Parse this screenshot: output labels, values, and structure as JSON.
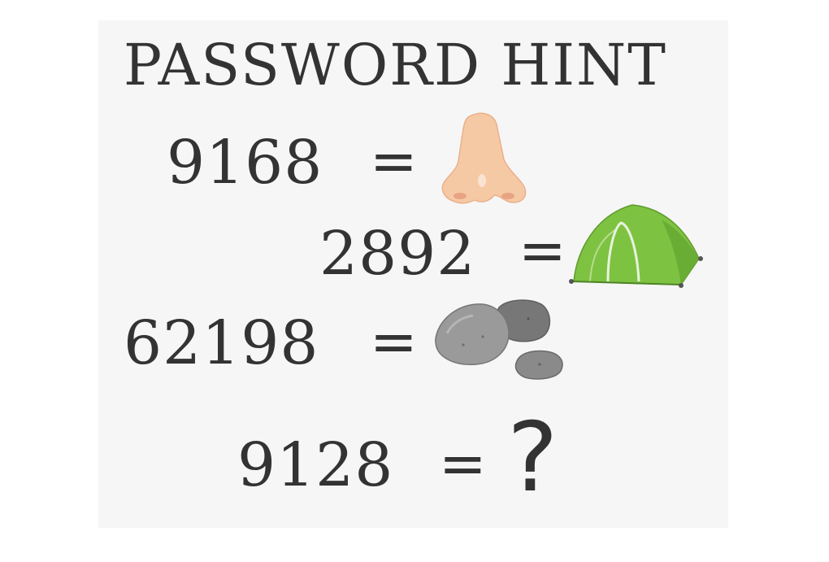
{
  "title": "PASSWORD HINT",
  "equations": [
    {
      "number": "9168",
      "equals": "=",
      "picture": "nose-icon"
    },
    {
      "number": "2892",
      "equals": "=",
      "picture": "tent-icon"
    },
    {
      "number": "62198",
      "equals": "=",
      "picture": "rocks-icon"
    },
    {
      "number": "9128",
      "equals": "=",
      "answer": "?"
    }
  ],
  "colors": {
    "text": "#333333",
    "card_background": "#f6f6f6",
    "nose": "#f6c9a5",
    "tent": "#7ec242",
    "rock": "#8f8f8f"
  }
}
